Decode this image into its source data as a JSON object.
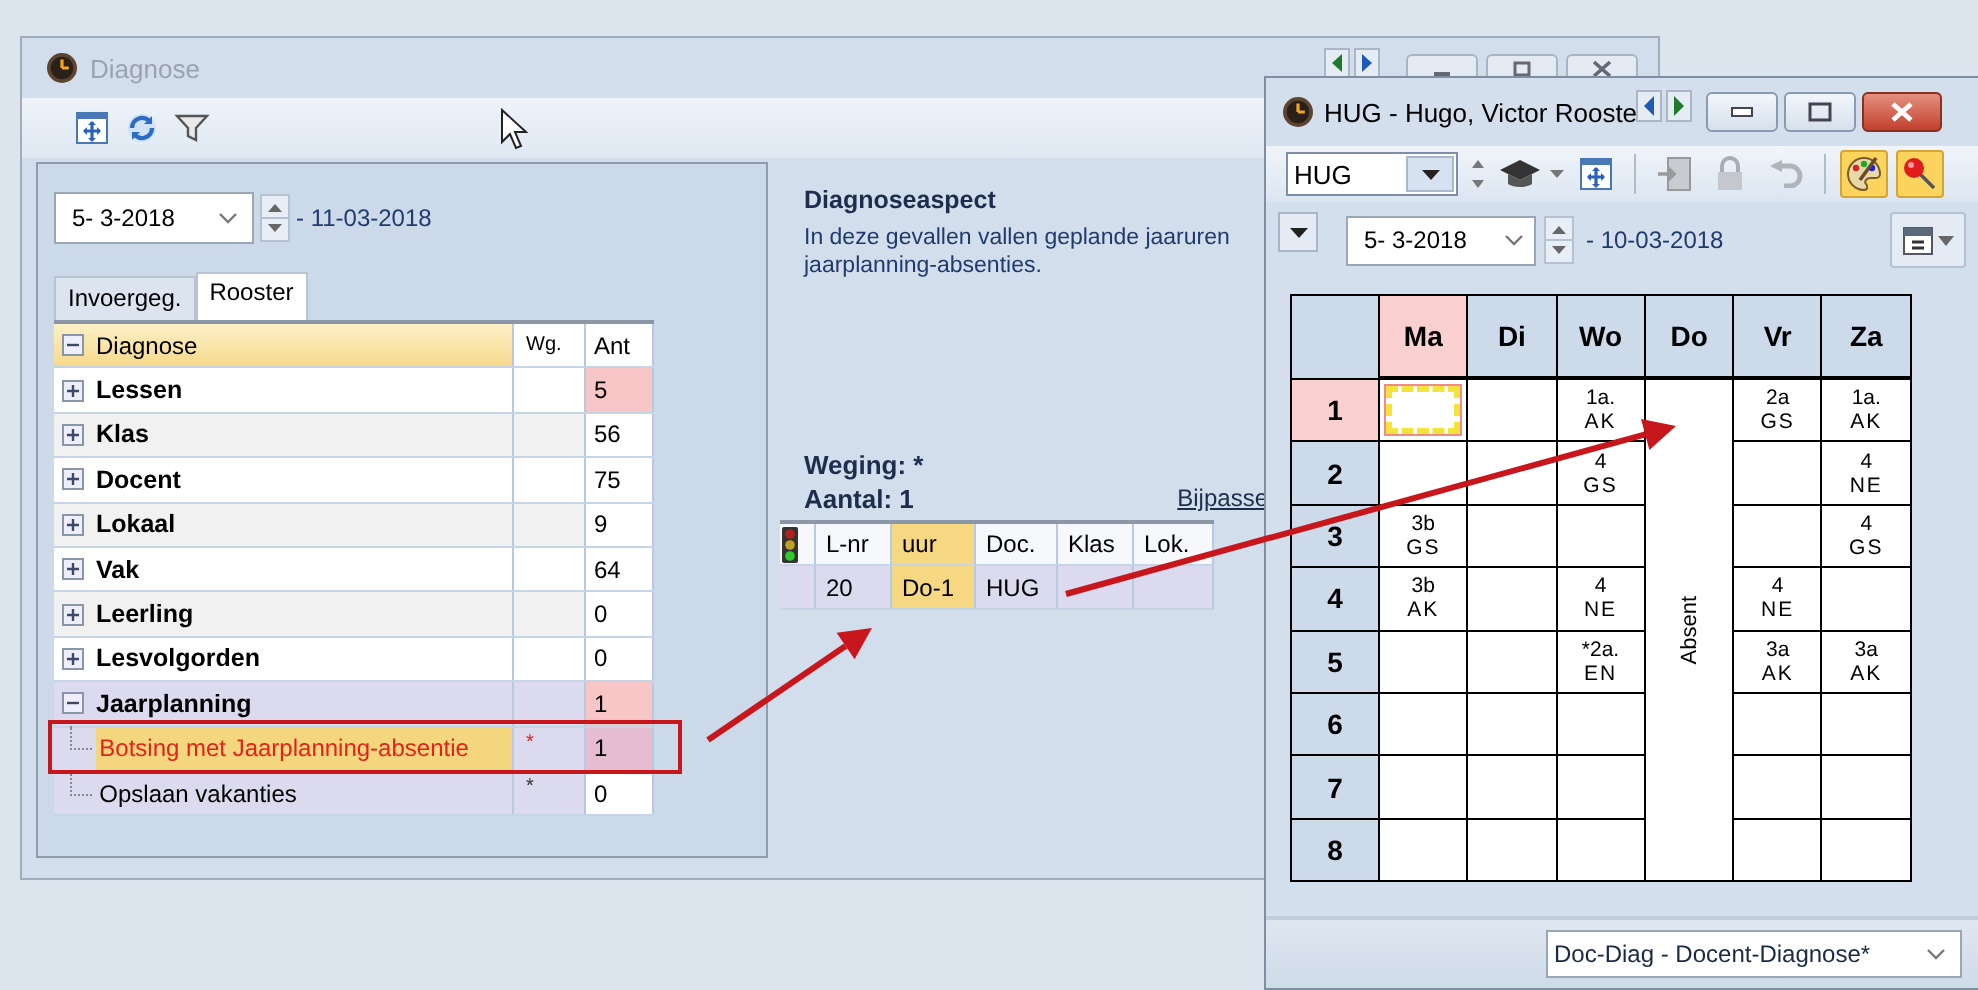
{
  "diagnose_window": {
    "title": "Diagnose",
    "date_from": "5- 3-2018",
    "date_to": "- 11-03-2018"
  },
  "tabs": [
    {
      "label": "Invoergeg.",
      "selected": false
    },
    {
      "label": "Rooster",
      "selected": true
    }
  ],
  "tree": {
    "columns": [
      "Diagnose",
      "Wg.",
      "Ant"
    ],
    "expanded": true,
    "items": [
      {
        "label": "Lessen",
        "expanded": false,
        "count": "5",
        "alert": true
      },
      {
        "label": "Klas",
        "expanded": false,
        "count": "56",
        "alert": false
      },
      {
        "label": "Docent",
        "expanded": false,
        "count": "75",
        "alert": false
      },
      {
        "label": "Lokaal",
        "expanded": false,
        "count": "9",
        "alert": false
      },
      {
        "label": "Vak",
        "expanded": false,
        "count": "64",
        "alert": false
      },
      {
        "label": "Leerling",
        "expanded": false,
        "count": "0",
        "alert": false
      },
      {
        "label": "Lesvolgorden",
        "expanded": false,
        "count": "0",
        "alert": false
      },
      {
        "label": "Jaarplanning",
        "expanded": true,
        "count": "1",
        "alert": true,
        "children": [
          {
            "label": "Botsing met Jaarplanning-absentie",
            "weight": "*",
            "count": "1",
            "alert": true,
            "selected": true
          },
          {
            "label": "Opslaan vakanties",
            "weight": "*",
            "count": "0",
            "alert": false,
            "selected": false
          }
        ]
      }
    ]
  },
  "aspect": {
    "heading": "Diagnoseaspect",
    "lines": [
      "In deze gevallen vallen geplande jaaruren",
      "jaarplanning-absenties."
    ],
    "weging": "Weging: *",
    "aantal": "Aantal: 1",
    "link": "Bijpasse"
  },
  "lessons": {
    "columns": [
      "L-nr",
      "uur",
      "Doc.",
      "Klas",
      "Lok."
    ],
    "rows": [
      {
        "lnr": "20",
        "uur": "Do-1",
        "doc": "HUG"
      }
    ]
  },
  "timetable_window": {
    "title": "HUG - Hugo, Victor  Rooste",
    "teacher": "HUG",
    "date_from": "5- 3-2018",
    "date_to": "- 10-03-2018"
  },
  "timetable": {
    "periods": [
      {
        "label": "1",
        "selected": true
      },
      {
        "label": "2",
        "selected": false
      },
      {
        "label": "3",
        "selected": false
      },
      {
        "label": "4",
        "selected": false
      },
      {
        "label": "5",
        "selected": false
      },
      {
        "label": "6",
        "selected": false
      },
      {
        "label": "7",
        "selected": false
      },
      {
        "label": "8",
        "selected": false
      }
    ],
    "days": [
      {
        "label": "Ma",
        "selected": true,
        "kind": "lessons",
        "slots": [
          {
            "selected": true
          },
          {
            "selected": false
          },
          {
            "selected": false,
            "class": "3b",
            "subject": "GS"
          },
          {
            "selected": false,
            "class": "3b",
            "subject": "AK"
          },
          {
            "selected": false
          },
          {
            "selected": false
          },
          {
            "selected": false
          },
          {
            "selected": false
          }
        ]
      },
      {
        "label": "Di",
        "selected": false,
        "kind": "lessons",
        "slots": [
          {
            "selected": false
          },
          {
            "selected": false
          },
          {
            "selected": false
          },
          {
            "selected": false
          },
          {
            "selected": false
          },
          {
            "selected": false
          },
          {
            "selected": false
          },
          {
            "selected": false
          }
        ]
      },
      {
        "label": "Wo",
        "selected": false,
        "kind": "lessons",
        "slots": [
          {
            "selected": false,
            "class": "1a.",
            "subject": "AK"
          },
          {
            "selected": false,
            "class": "4",
            "subject": "GS"
          },
          {
            "selected": false
          },
          {
            "selected": false,
            "class": "4",
            "subject": "NE"
          },
          {
            "selected": false,
            "class": "*2a.",
            "subject": "EN"
          },
          {
            "selected": false
          },
          {
            "selected": false
          },
          {
            "selected": false
          }
        ]
      },
      {
        "label": "Do",
        "selected": false,
        "kind": "absent",
        "note": "Absent"
      },
      {
        "label": "Vr",
        "selected": false,
        "kind": "lessons",
        "slots": [
          {
            "selected": false,
            "class": "2a",
            "subject": "GS"
          },
          {
            "selected": false
          },
          {
            "selected": false
          },
          {
            "selected": false,
            "class": "4",
            "subject": "NE"
          },
          {
            "selected": false,
            "class": "3a",
            "subject": "AK"
          },
          {
            "selected": false
          },
          {
            "selected": false
          },
          {
            "selected": false
          }
        ]
      },
      {
        "label": "Za",
        "selected": false,
        "kind": "lessons",
        "slots": [
          {
            "selected": false,
            "class": "1a.",
            "subject": "AK"
          },
          {
            "selected": false,
            "class": "4",
            "subject": "NE"
          },
          {
            "selected": false,
            "class": "4",
            "subject": "GS"
          },
          {
            "selected": false
          },
          {
            "selected": false,
            "class": "3a",
            "subject": "AK"
          },
          {
            "selected": false
          },
          {
            "selected": false
          },
          {
            "selected": false
          }
        ]
      }
    ]
  },
  "view_select": "Doc-Diag - Docent-Diagnose*"
}
